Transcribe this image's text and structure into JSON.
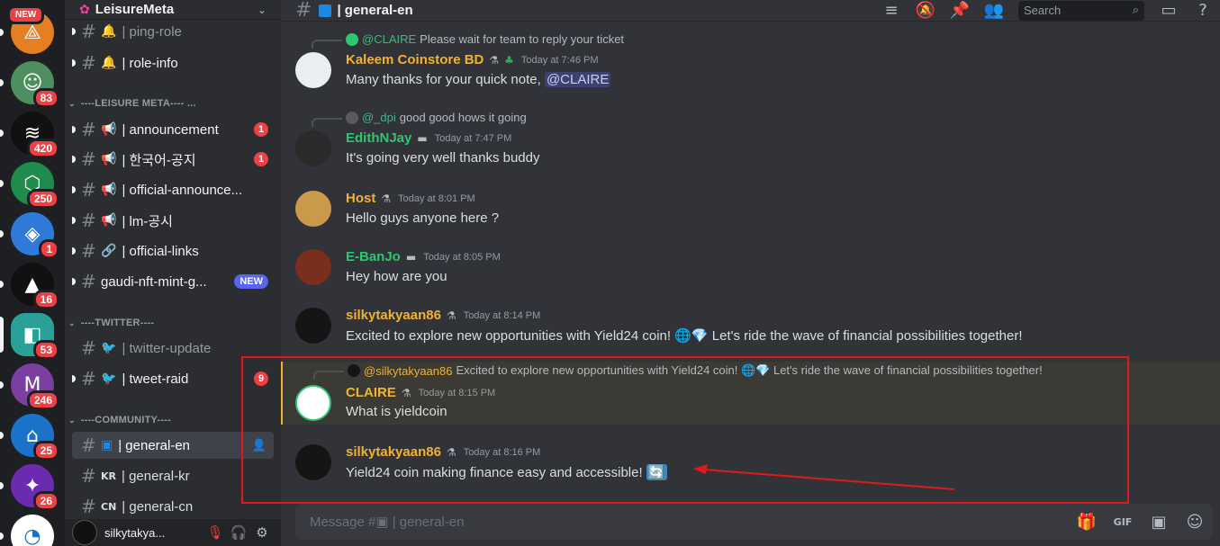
{
  "rail": {
    "new_label": "NEW",
    "servers": [
      {
        "name": "server-1",
        "badge": "",
        "color": "#e67e22",
        "glyph": "⟁",
        "new": true
      },
      {
        "name": "server-2",
        "badge": "83",
        "color": "#4e8f5f",
        "glyph": "☺"
      },
      {
        "name": "server-3",
        "badge": "420",
        "color": "#111111",
        "glyph": "≋"
      },
      {
        "name": "server-4",
        "badge": "250",
        "color": "#1f8b4c",
        "glyph": "⬡"
      },
      {
        "name": "server-5",
        "badge": "1",
        "color": "#2f7ad9",
        "glyph": "◈"
      },
      {
        "name": "server-6",
        "badge": "16",
        "color": "#111111",
        "glyph": "▲"
      },
      {
        "name": "server-7",
        "badge": "53",
        "color": "#2aa198",
        "glyph": "◧"
      },
      {
        "name": "server-8",
        "badge": "246",
        "color": "#7b3fa0",
        "glyph": "M"
      },
      {
        "name": "server-9",
        "badge": "25",
        "color": "#1a73c9",
        "glyph": "⌂"
      },
      {
        "name": "server-10",
        "badge": "26",
        "color": "#6a2bb0",
        "glyph": "✦"
      },
      {
        "name": "server-11",
        "badge": "",
        "color": "#ffffff",
        "glyph": "◔"
      }
    ]
  },
  "sidebar": {
    "guild_name": "LeisureMeta",
    "categories": {
      "leisure": "----LEISURE META---- ...",
      "twitter": "----TWITTER----",
      "community": "----COMMUNITY----"
    },
    "channels": {
      "ping_role": {
        "icon": "🔔",
        "label": "| ping-role"
      },
      "role_info": {
        "icon": "🔔",
        "label": "| role-info"
      },
      "announcement": {
        "icon": "📢",
        "label": "| announcement",
        "count": "1"
      },
      "korean_notice": {
        "icon": "📢",
        "label": "| 한국어-공지",
        "count": "1"
      },
      "official_announce": {
        "icon": "📢",
        "label": "| official-announce..."
      },
      "lm_notice": {
        "icon": "📢",
        "label": "| lm-공시"
      },
      "official_links": {
        "icon": "🔗",
        "label": "| official-links"
      },
      "gaudi": {
        "label": "gaudi-nft-mint-g...",
        "tag": "NEW"
      },
      "twitter_update": {
        "icon": "🐦",
        "label": "| twitter-update"
      },
      "tweet_raid": {
        "icon": "🐦",
        "label": "| tweet-raid",
        "count": "9"
      },
      "general_en": {
        "icon": "▣",
        "label": "| general-en"
      },
      "general_kr": {
        "icon": "KR",
        "label": "| general-kr"
      },
      "general_cn": {
        "icon": "CN",
        "label": "| general-cn"
      }
    },
    "user": {
      "name": "silkytakya..."
    }
  },
  "header": {
    "channel_title": "| general-en",
    "search_placeholder": "Search"
  },
  "messages": [
    {
      "reply_to": "@CLAIRE",
      "reply_text": "Please wait for team to reply your ticket",
      "author": "Kaleem Coinstore BD",
      "author_color": "#f0b232",
      "time": "Today at 7:46 PM",
      "text": "Many thanks for your quick note, ",
      "mention": "@CLAIRE"
    },
    {
      "reply_to": "@_dpi",
      "reply_text": "good good hows it going",
      "author": "EdithNJay",
      "author_color": "#2dc770",
      "time": "Today at 7:47 PM",
      "text": "It's going very well thanks buddy"
    },
    {
      "author": "Host",
      "author_color": "#f0b232",
      "time": "Today at 8:01 PM",
      "text": "Hello guys anyone here ?"
    },
    {
      "author": "E-BanJo",
      "author_color": "#2dc770",
      "time": "Today at 8:05 PM",
      "text": "Hey how are you"
    },
    {
      "author": "silkytakyaan86",
      "author_color": "#f0b232",
      "time": "Today at 8:14 PM",
      "text": "Excited to explore new opportunities with Yield24 coin!",
      "text_tail": "Let's ride the wave of financial possibilities together!"
    },
    {
      "reply_to": "@silkytakyaan86",
      "reply_text": "Excited to explore new opportunities with Yield24 coin! 🌐💎 Let's ride the wave of financial possibilities together!",
      "author": "CLAIRE",
      "author_color": "#f0b232",
      "time": "Today at 8:15 PM",
      "text": "What is yieldcoin"
    },
    {
      "author": "silkytakyaan86",
      "author_color": "#f0b232",
      "time": "Today at 8:16 PM",
      "text": "Yield24 coin making finance easy and accessible!"
    }
  ],
  "composer": {
    "placeholder": "Message #▣ | general-en"
  },
  "colors": {
    "accent": "#5865f2",
    "danger": "#f23f43",
    "annotation": "#e01919"
  }
}
